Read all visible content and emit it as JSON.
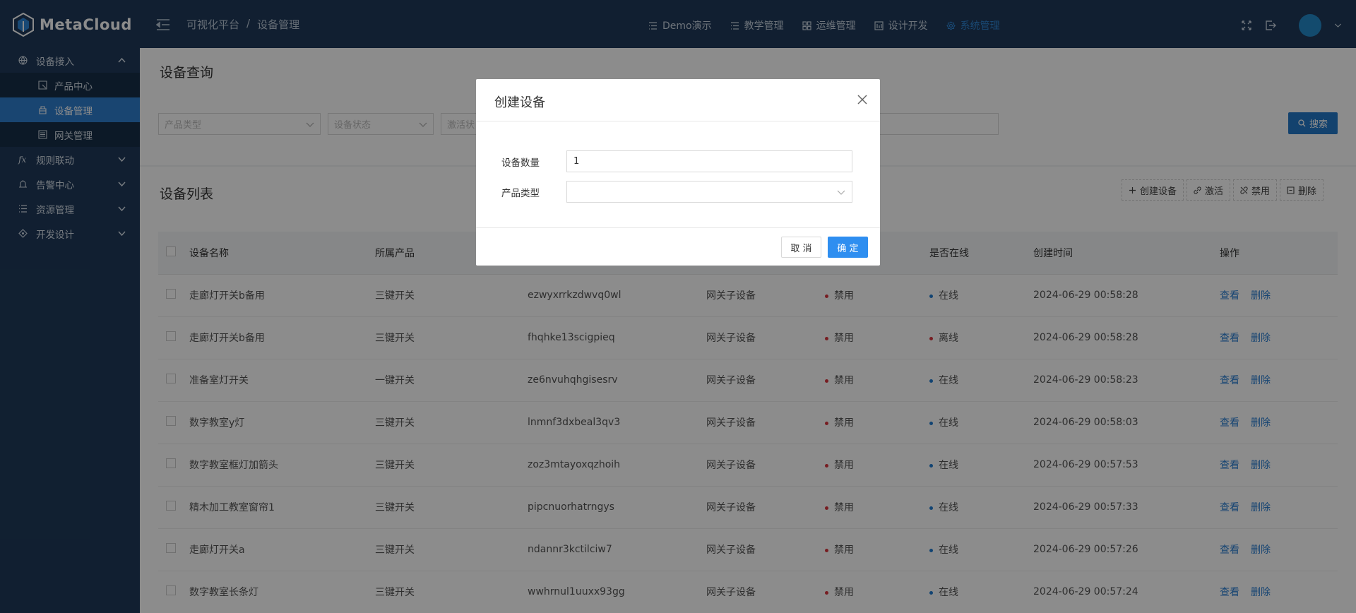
{
  "app": {
    "logo_text": "MetaCloud"
  },
  "breadcrumb": {
    "root": "可视化平台",
    "separator": "/",
    "current": "设备管理"
  },
  "top_nav": [
    {
      "label": "Demo演示",
      "icon": "list-icon"
    },
    {
      "label": "教学管理",
      "icon": "list-icon"
    },
    {
      "label": "运维管理",
      "icon": "grid-icon"
    },
    {
      "label": "设计开发",
      "icon": "layout-icon"
    },
    {
      "label": "系统管理",
      "icon": "gear-icon",
      "active": true
    }
  ],
  "sidebar": {
    "groups": [
      {
        "label": "设备接入",
        "icon": "globe-icon",
        "expanded": true,
        "items": [
          {
            "label": "产品中心",
            "icon": "product-icon"
          },
          {
            "label": "设备管理",
            "icon": "device-icon",
            "active": true
          },
          {
            "label": "网关管理",
            "icon": "gateway-icon"
          }
        ]
      },
      {
        "label": "规则联动",
        "icon": "fx-icon",
        "fx_text": "fx"
      },
      {
        "label": "告警中心",
        "icon": "alarm-icon"
      },
      {
        "label": "资源管理",
        "icon": "list-icon"
      },
      {
        "label": "开发设计",
        "icon": "design-icon"
      }
    ]
  },
  "query": {
    "title": "设备查询",
    "filters": [
      "产品类型",
      "设备状态",
      "激活状"
    ],
    "search_label": "搜索"
  },
  "list": {
    "title": "设备列表",
    "actions": [
      "创建设备",
      "激活",
      "禁用",
      "删除"
    ],
    "columns": [
      "设备名称",
      "所属产品",
      "",
      "",
      "",
      "是否在线",
      "创建时间",
      "操作"
    ],
    "view_label": "查看",
    "delete_label": "删除",
    "rows": [
      {
        "name": "走廊灯开关b备用",
        "product": "三键开关",
        "key": "ezwyxrrkzdwvq0wl",
        "type": "网关子设备",
        "status": "禁用",
        "online": "在线",
        "time": "2024-06-29 00:58:28"
      },
      {
        "name": "走廊灯开关b备用",
        "product": "三键开关",
        "key": "fhqhke13scigpieq",
        "type": "网关子设备",
        "status": "禁用",
        "online": "离线",
        "time": "2024-06-29 00:58:28"
      },
      {
        "name": "准备室灯开关",
        "product": "一键开关",
        "key": "ze6nvuhqhgisesrv",
        "type": "网关子设备",
        "status": "禁用",
        "online": "在线",
        "time": "2024-06-29 00:58:23"
      },
      {
        "name": "数字教室y灯",
        "product": "三键开关",
        "key": "lnmnf3dxbeal3qv3",
        "type": "网关子设备",
        "status": "禁用",
        "online": "在线",
        "time": "2024-06-29 00:58:03"
      },
      {
        "name": "数字教室框灯加箭头",
        "product": "三键开关",
        "key": "zoz3mtayoxqzhoih",
        "type": "网关子设备",
        "status": "禁用",
        "online": "在线",
        "time": "2024-06-29 00:57:53"
      },
      {
        "name": "精木加工教室窗帘1",
        "product": "三键开关",
        "key": "pipcnuorhatrngys",
        "type": "网关子设备",
        "status": "禁用",
        "online": "在线",
        "time": "2024-06-29 00:57:33"
      },
      {
        "name": "走廊灯开关a",
        "product": "三键开关",
        "key": "ndannr3kctilciw7",
        "type": "网关子设备",
        "status": "禁用",
        "online": "在线",
        "time": "2024-06-29 00:57:26"
      },
      {
        "name": "数字教室长条灯",
        "product": "三键开关",
        "key": "wwhrnul1uuxx93gg",
        "type": "网关子设备",
        "status": "禁用",
        "online": "在线",
        "time": "2024-06-29 00:57:24"
      }
    ]
  },
  "modal": {
    "title": "创建设备",
    "count_label": "设备数量",
    "count_value": "1",
    "product_label": "产品类型",
    "product_value": "",
    "cancel_label": "取 消",
    "ok_label": "确 定"
  },
  "colors": {
    "sidebar_bg": "#1f3a5a",
    "accent": "#2f7fce",
    "danger_dot": "#d9363e",
    "online_dot": "#1f7bd0",
    "offline_dot": "#d9363e"
  }
}
